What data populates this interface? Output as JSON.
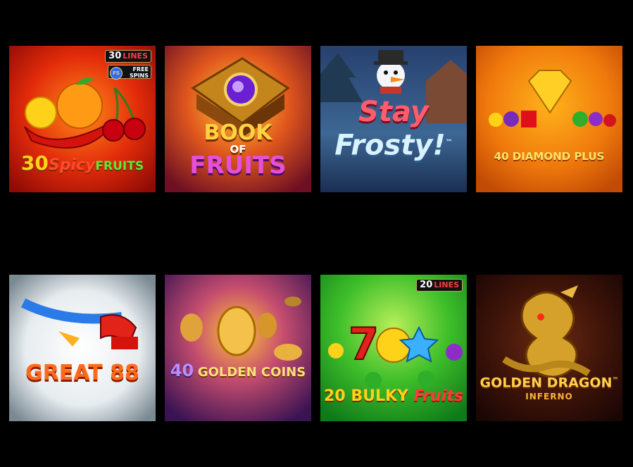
{
  "games": [
    {
      "title_parts": [
        "30",
        "Spicy",
        "FRUITS"
      ],
      "badge_number": "30",
      "badge_label": "LINES",
      "free_spins_label": "FREE SPINS",
      "free_spins_icon": "FS"
    },
    {
      "title_parts": [
        "BOOK",
        "OF",
        "FRUITS"
      ]
    },
    {
      "title_parts": [
        "Stay",
        "Frosty!",
        "™"
      ]
    },
    {
      "title": "40 DIAMOND PLUS"
    },
    {
      "title": "GREAT 88"
    },
    {
      "title_parts": [
        "40",
        "GOLDEN COINS"
      ]
    },
    {
      "title_parts": [
        "20",
        "BULKY",
        "Fruits"
      ],
      "badge_number": "20",
      "badge_label": "LINES"
    },
    {
      "title_parts": [
        "GOLDEN DRAGON",
        "INFERNO",
        "™"
      ]
    }
  ]
}
